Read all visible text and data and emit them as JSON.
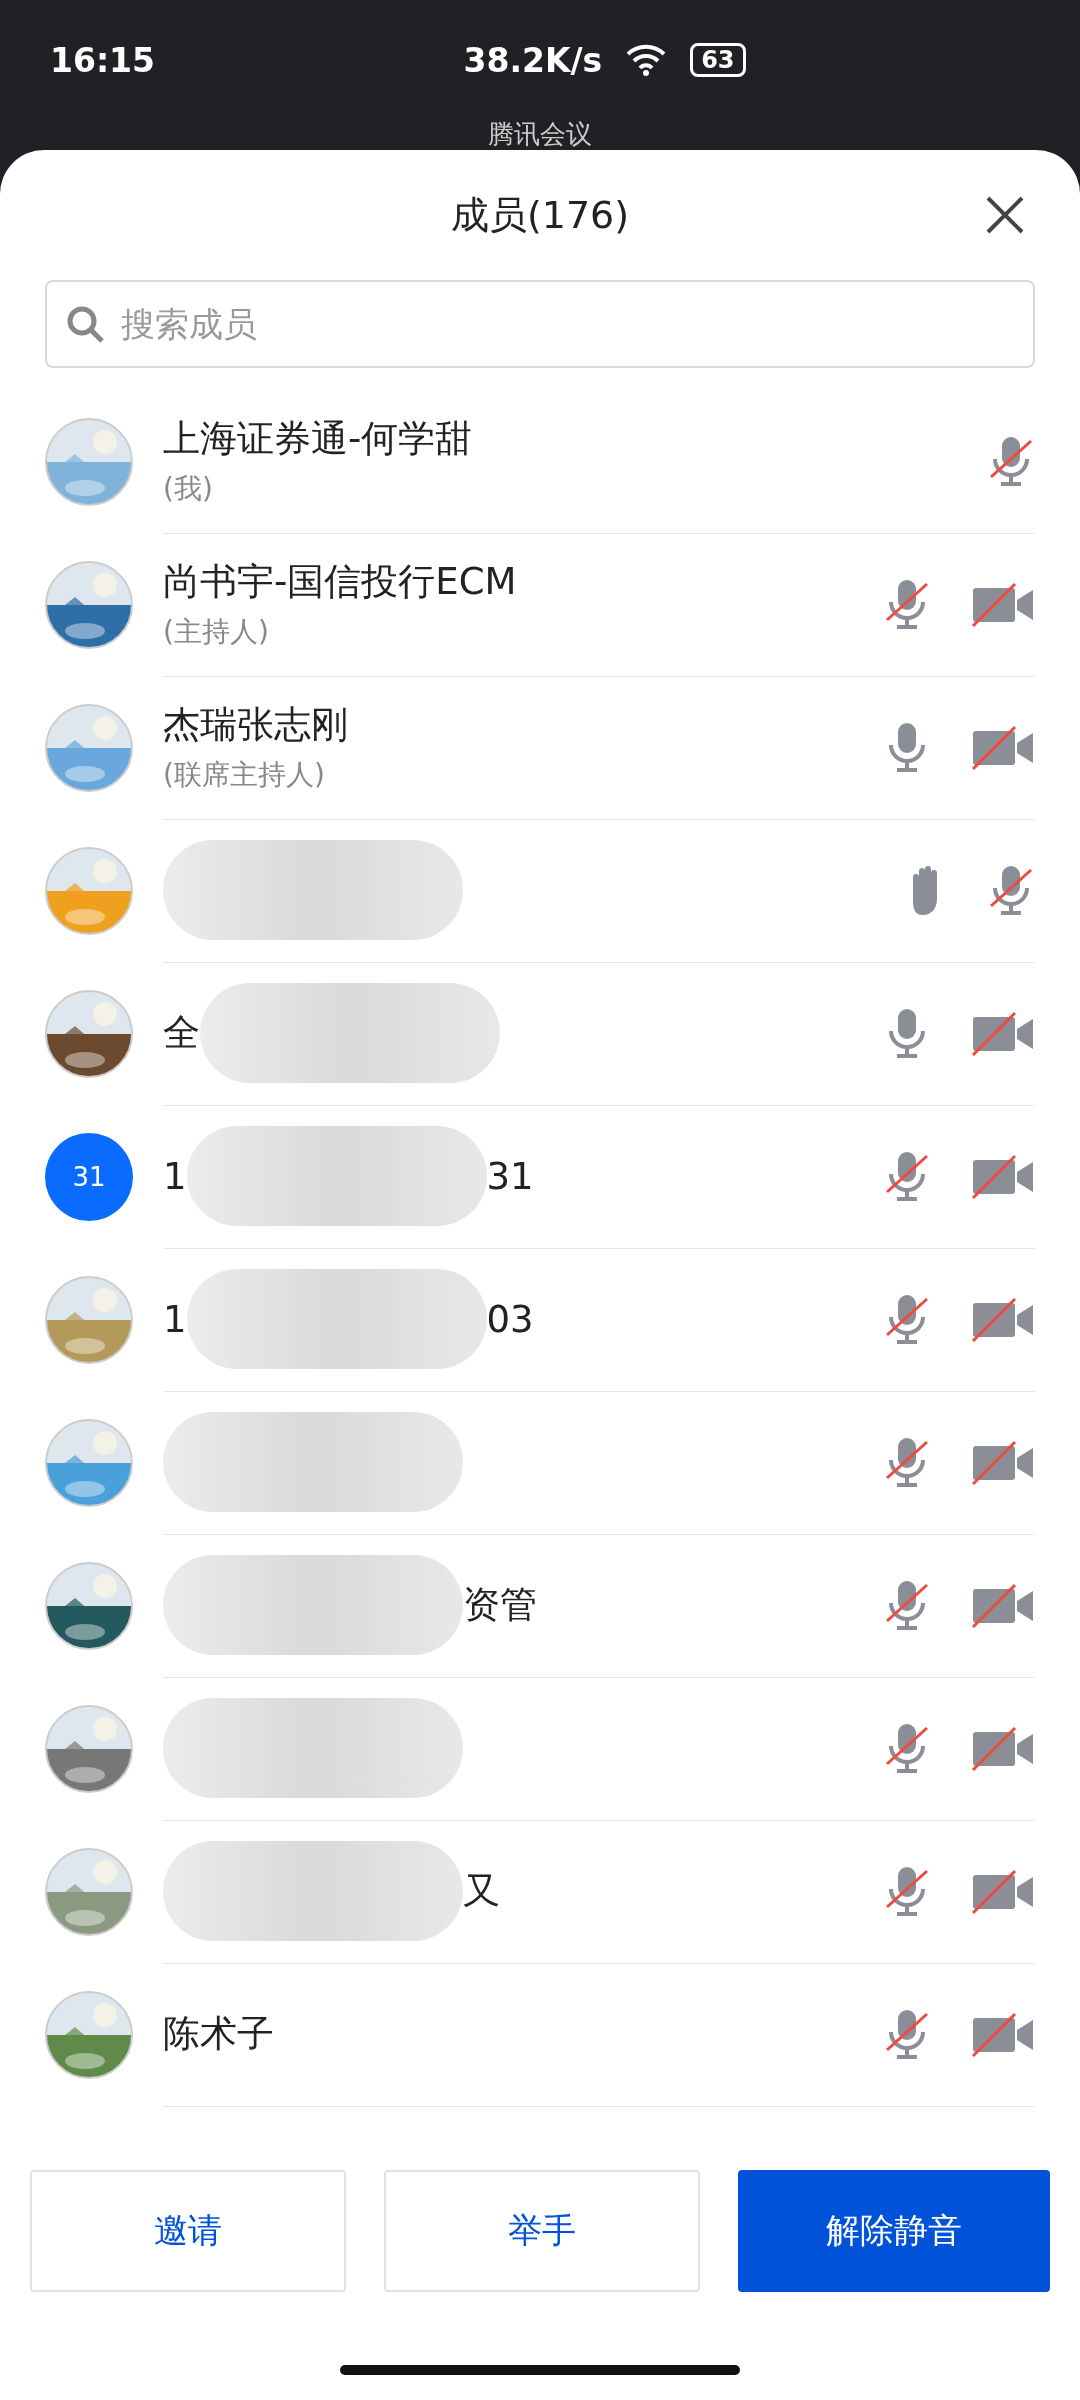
{
  "status_bar": {
    "time": "16:15",
    "speed": "38.2K/s",
    "battery": "63"
  },
  "app_header": {
    "title": "腾讯会议"
  },
  "sheet": {
    "title": "成员(176)"
  },
  "search": {
    "placeholder": "搜索成员"
  },
  "members": [
    {
      "avatar": {
        "kind": "picture"
      },
      "name_before": "上海证券通-何学甜",
      "redacted": false,
      "role": "(我)",
      "icons": [
        {
          "kind": "mic",
          "muted": true
        }
      ]
    },
    {
      "avatar": {
        "kind": "picture"
      },
      "name_before": "尚书宇-国信投行ECM",
      "redacted": false,
      "role": "(主持人)",
      "icons": [
        {
          "kind": "mic",
          "muted": true
        },
        {
          "kind": "camera",
          "muted": true
        }
      ]
    },
    {
      "avatar": {
        "kind": "picture"
      },
      "name_before": "杰瑞张志刚",
      "redacted": false,
      "role": "(联席主持人)",
      "icons": [
        {
          "kind": "mic",
          "muted": false
        },
        {
          "kind": "camera",
          "muted": true
        }
      ]
    },
    {
      "avatar": {
        "kind": "picture"
      },
      "redacted": true,
      "icons": [
        {
          "kind": "hand"
        },
        {
          "kind": "mic",
          "muted": true
        }
      ]
    },
    {
      "avatar": {
        "kind": "picture"
      },
      "name_before": "全",
      "redacted": true,
      "icons": [
        {
          "kind": "mic",
          "muted": false
        },
        {
          "kind": "camera",
          "muted": true
        }
      ]
    },
    {
      "avatar": {
        "kind": "initials",
        "text": "31",
        "color": "#0a6cff"
      },
      "name_before": "1",
      "name_after": "31",
      "redacted": true,
      "icons": [
        {
          "kind": "mic",
          "muted": true
        },
        {
          "kind": "camera",
          "muted": true
        }
      ]
    },
    {
      "avatar": {
        "kind": "picture"
      },
      "name_before": "1",
      "name_after": "03",
      "redacted": true,
      "icons": [
        {
          "kind": "mic",
          "muted": true
        },
        {
          "kind": "camera",
          "muted": true
        }
      ]
    },
    {
      "avatar": {
        "kind": "picture"
      },
      "redacted": true,
      "icons": [
        {
          "kind": "mic",
          "muted": true
        },
        {
          "kind": "camera",
          "muted": true
        }
      ]
    },
    {
      "avatar": {
        "kind": "picture"
      },
      "name_after": "资管",
      "redacted": true,
      "icons": [
        {
          "kind": "mic",
          "muted": true
        },
        {
          "kind": "camera",
          "muted": true
        }
      ]
    },
    {
      "avatar": {
        "kind": "picture"
      },
      "redacted": true,
      "icons": [
        {
          "kind": "mic",
          "muted": true
        },
        {
          "kind": "camera",
          "muted": true
        }
      ]
    },
    {
      "avatar": {
        "kind": "picture"
      },
      "name_after": "又",
      "redacted": true,
      "icons": [
        {
          "kind": "mic",
          "muted": true
        },
        {
          "kind": "camera",
          "muted": true
        }
      ]
    },
    {
      "avatar": {
        "kind": "picture"
      },
      "name_before": "陈术子",
      "redacted": false,
      "icons": [
        {
          "kind": "mic",
          "muted": true
        },
        {
          "kind": "camera",
          "muted": true
        }
      ]
    }
  ],
  "buttons": [
    {
      "label": "邀请",
      "primary": false
    },
    {
      "label": "举手",
      "primary": false
    },
    {
      "label": "解除静音",
      "primary": true
    }
  ]
}
